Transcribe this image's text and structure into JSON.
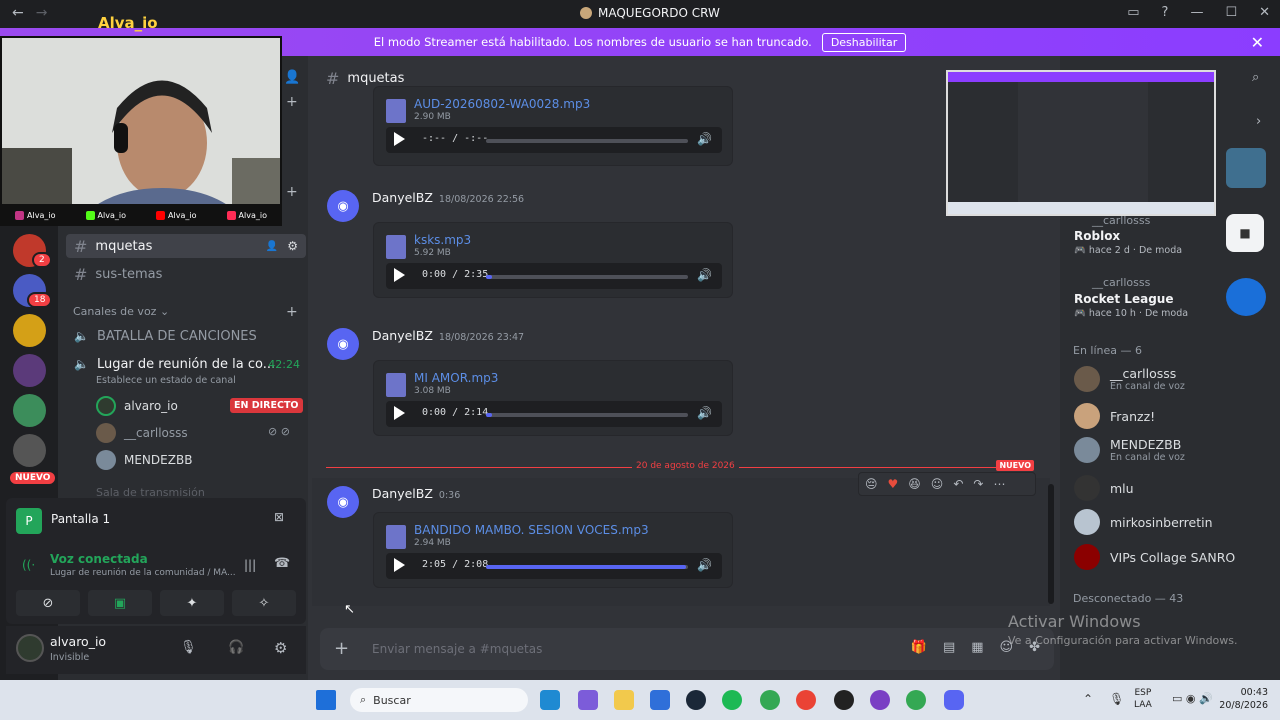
{
  "window": {
    "title": "MAQUEGORDO CRW"
  },
  "streamer_bar": {
    "message": "El modo Streamer está habilitado. Los nombres de usuario se han truncado.",
    "disable_label": "Deshabilitar"
  },
  "overlay": {
    "cam_name": "Alva_io",
    "socials": [
      "Alva_io",
      "Alva_io",
      "Alva_io",
      "Alva_io"
    ]
  },
  "servers": {
    "badges": [
      "2",
      "18"
    ],
    "new_label": "NUEVO"
  },
  "channels": {
    "text": [
      "mquetas",
      "sus-temas"
    ],
    "voice_header": "Canales de voz",
    "voice": [
      {
        "name": "BATALLA DE CANCIONES"
      },
      {
        "name": "Lugar de reunión de la co...",
        "timer": "42:24",
        "status": "Establece un estado de canal"
      }
    ],
    "voice_users": [
      {
        "name": "alvaro_io",
        "live": "EN DIRECTO"
      },
      {
        "name": "__carllosss"
      },
      {
        "name": "MENDEZBB"
      }
    ],
    "cut": "Sala de transmisión"
  },
  "panel": {
    "screen": "Pantalla 1",
    "voice_status": "Voz conectada",
    "voice_location": "Lugar de reunión de la comunidad / MA..."
  },
  "user": {
    "name": "alvaro_io",
    "status": "Invisible"
  },
  "chat": {
    "channel": "mquetas",
    "first_attach": {
      "file": "AUD-20260802-WA0028.mp3",
      "size": "2.90 MB",
      "time": "-:-- / -:--",
      "progress": 0
    },
    "messages": [
      {
        "author": "DanyelBZ",
        "time": "18/08/2026 22:56",
        "file": "ksks.mp3",
        "size": "5.92 MB",
        "player_time": "0:00 / 2:35",
        "progress": 0.03
      },
      {
        "author": "DanyelBZ",
        "time": "18/08/2026 23:47",
        "file": "MI AMOR.mp3",
        "size": "3.08 MB",
        "player_time": "0:00 / 2:14",
        "progress": 0.03
      },
      {
        "author": "DanyelBZ",
        "time": "0:36",
        "file": "BANDIDO MAMBO. SESION VOCES.mp3",
        "size": "2.94 MB",
        "player_time": "2:05 / 2:08",
        "progress": 0.99
      }
    ],
    "divider_date": "20 de agosto de 2026",
    "divider_new": "NUEVO",
    "placeholder": "Enviar mensaje a #mquetas"
  },
  "members": {
    "activity": [
      {
        "user": "__carllosss",
        "game": "Roblox",
        "when": "hace 2 d",
        "tag": "De moda"
      },
      {
        "user": "__carllosss",
        "game": "Rocket League",
        "when": "hace 10 h",
        "tag": "De moda"
      }
    ],
    "online_header": "En línea — 6",
    "online": [
      {
        "name": "__carllosss",
        "sub": "En canal de voz"
      },
      {
        "name": "Franzz!",
        "sub": ""
      },
      {
        "name": "MENDEZBB",
        "sub": "En canal de voz"
      },
      {
        "name": "mlu",
        "sub": ""
      },
      {
        "name": "mirkosinberretin",
        "sub": ""
      },
      {
        "name": "VIPs Collage SANRO",
        "sub": ""
      }
    ],
    "offline_header": "Desconectado — 43"
  },
  "watermark": {
    "title": "Activar Windows",
    "subtitle": "Ve a Configuración para activar Windows."
  },
  "taskbar": {
    "search": "Buscar",
    "lang": "ESP",
    "lang2": "LAA",
    "time": "00:43",
    "date": "20/8/2026"
  }
}
